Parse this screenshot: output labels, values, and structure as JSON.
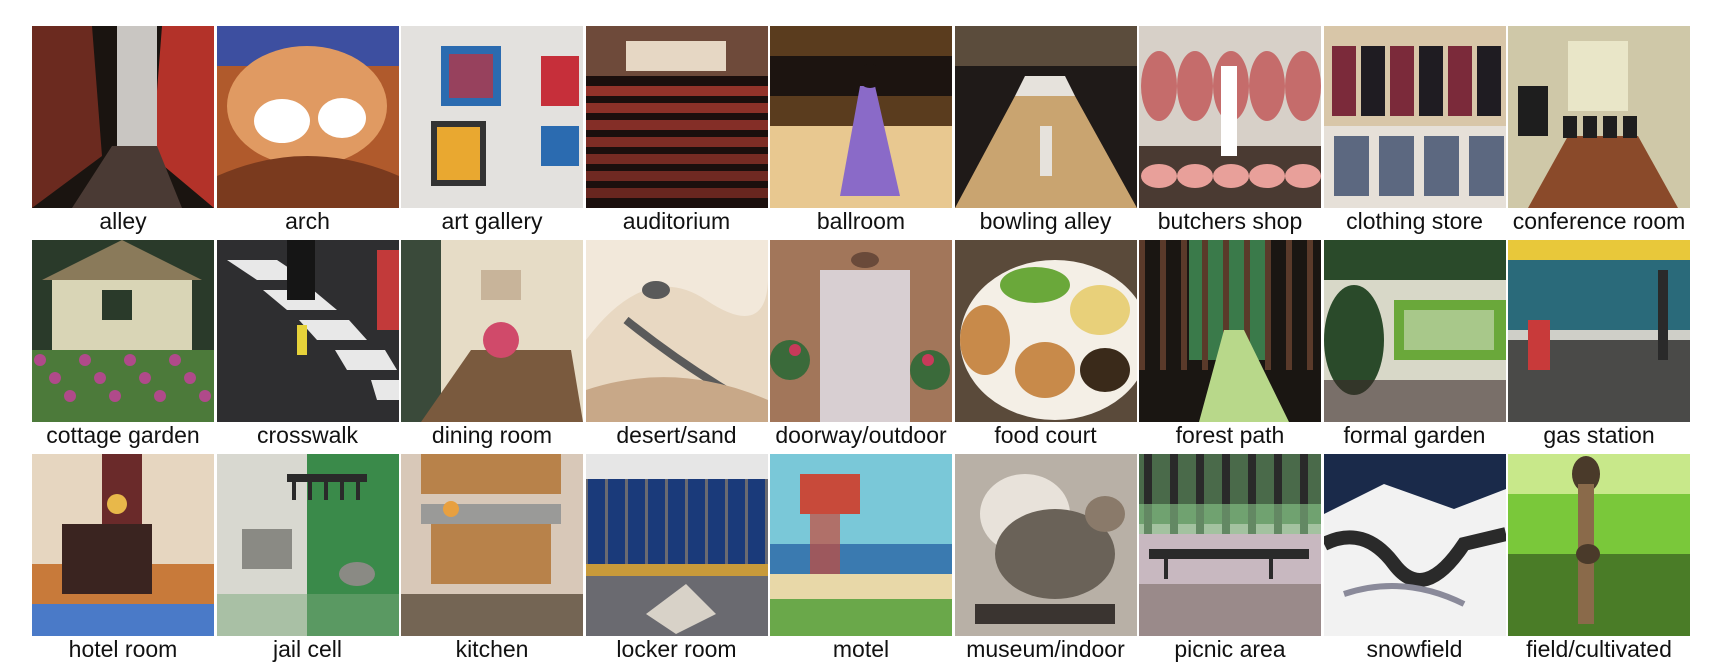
{
  "figure": {
    "rows": [
      [
        {
          "label": "alley",
          "palette": [
            "#2a1512",
            "#6b2a1f",
            "#c9c6c2",
            "#d93a2f",
            "#1a1410"
          ],
          "scene": "alley"
        },
        {
          "label": "arch",
          "palette": [
            "#b05a2c",
            "#e09a62",
            "#ffffff",
            "#3d4fa0",
            "#7a3a1e"
          ],
          "scene": "arch"
        },
        {
          "label": "art gallery",
          "palette": [
            "#e3e1de",
            "#c62f3a",
            "#2b6bb0",
            "#e9a830",
            "#333333"
          ],
          "scene": "gallery"
        },
        {
          "label": "auditorium",
          "palette": [
            "#3b1d1a",
            "#a83a30",
            "#e6d7c4",
            "#6e4a3a",
            "#1b0f0d"
          ],
          "scene": "auditorium"
        },
        {
          "label": "ballroom",
          "palette": [
            "#5a3c1e",
            "#c9a15a",
            "#8a6ac8",
            "#1c1410",
            "#e8c890"
          ],
          "scene": "ballroom"
        },
        {
          "label": "bowling alley",
          "palette": [
            "#1f1a18",
            "#c9a470",
            "#e6e2dc",
            "#5b4c3c",
            "#8e7c62"
          ],
          "scene": "bowling"
        },
        {
          "label": "butchers shop",
          "palette": [
            "#d7d0c8",
            "#c25a5a",
            "#e8a09a",
            "#4a3a32",
            "#ffffff"
          ],
          "scene": "butcher"
        },
        {
          "label": "clothing store",
          "palette": [
            "#d8c6a8",
            "#1f1c22",
            "#7b2a3a",
            "#e6e0d8",
            "#3a4a6a"
          ],
          "scene": "clothing"
        },
        {
          "label": "conference room",
          "palette": [
            "#cfc8a8",
            "#8a4a2a",
            "#1e1e1e",
            "#e9e6c8",
            "#6a6a58"
          ],
          "scene": "conference"
        }
      ],
      [
        {
          "label": "cottage garden",
          "palette": [
            "#d9d5b6",
            "#4c7a3a",
            "#b04a8a",
            "#8a7a5a",
            "#2a3a2a"
          ],
          "scene": "cottage"
        },
        {
          "label": "crosswalk",
          "palette": [
            "#2e2e30",
            "#e8e8e8",
            "#8a8a8a",
            "#e6d23a",
            "#c23a3a"
          ],
          "scene": "crosswalk"
        },
        {
          "label": "dining room",
          "palette": [
            "#7a5a3e",
            "#c8b49a",
            "#3a4a3a",
            "#d04a6a",
            "#e6dcc6"
          ],
          "scene": "dining"
        },
        {
          "label": "desert/sand",
          "palette": [
            "#e8d8c2",
            "#c8a888",
            "#5a5a5a",
            "#b08868",
            "#f2e8da"
          ],
          "scene": "desert"
        },
        {
          "label": "doorway/outdoor",
          "palette": [
            "#a2765a",
            "#d8cfd2",
            "#3a6a3a",
            "#c83a5a",
            "#6a4a3a"
          ],
          "scene": "doorway"
        },
        {
          "label": "food court",
          "palette": [
            "#f4efe6",
            "#c88a4a",
            "#6aa83a",
            "#e8d07a",
            "#3a2a1a"
          ],
          "scene": "food"
        },
        {
          "label": "forest path",
          "palette": [
            "#1a1612",
            "#3a7a4a",
            "#b8d88a",
            "#5a3a2a",
            "#8ac8a8"
          ],
          "scene": "forest"
        },
        {
          "label": "formal garden",
          "palette": [
            "#2a4a2a",
            "#6aa83a",
            "#a8c88a",
            "#3a2a2a",
            "#d8d8c8"
          ],
          "scene": "formalgarden"
        },
        {
          "label": "gas station",
          "palette": [
            "#cfcfc8",
            "#2a6a7a",
            "#e8c83a",
            "#4a4a48",
            "#c83a3a"
          ],
          "scene": "gas"
        }
      ],
      [
        {
          "label": "hotel room",
          "palette": [
            "#e6d6c0",
            "#3a2420",
            "#c87a3a",
            "#4a7ac8",
            "#e8b84a"
          ],
          "scene": "hotel"
        },
        {
          "label": "jail cell",
          "palette": [
            "#3a8a4a",
            "#d8d8d0",
            "#2a2a2a",
            "#7aa87a",
            "#8a8a84"
          ],
          "scene": "jail"
        },
        {
          "label": "kitchen",
          "palette": [
            "#b8824a",
            "#d8c8b8",
            "#4a3a2a",
            "#e8a040",
            "#9a9a98"
          ],
          "scene": "kitchen"
        },
        {
          "label": "locker room",
          "palette": [
            "#1a3a7a",
            "#d8d2c8",
            "#c89a3a",
            "#6a6a70",
            "#e6e6e6"
          ],
          "scene": "locker"
        },
        {
          "label": "motel",
          "palette": [
            "#3a7ab0",
            "#c84a3a",
            "#6aa84a",
            "#e8d8a8",
            "#7ac8d8"
          ],
          "scene": "motel"
        },
        {
          "label": "museum/indoor",
          "palette": [
            "#b8b0a6",
            "#6a6258",
            "#e8e2da",
            "#3a3430",
            "#8a7a6a"
          ],
          "scene": "museum"
        },
        {
          "label": "picnic area",
          "palette": [
            "#4a6a4a",
            "#9a8a8a",
            "#2a2a2a",
            "#c8b8c0",
            "#8ac88a"
          ],
          "scene": "picnic"
        },
        {
          "label": "snowfield",
          "palette": [
            "#1a2a4a",
            "#f2f2f2",
            "#2a2a2a",
            "#8a8a9a",
            "#ffffff"
          ],
          "scene": "snow"
        },
        {
          "label": "field/cultivated",
          "palette": [
            "#7ac83a",
            "#4a3a2a",
            "#c8e88a",
            "#2a4a1a",
            "#8a6a4a"
          ],
          "scene": "field"
        }
      ]
    ]
  }
}
